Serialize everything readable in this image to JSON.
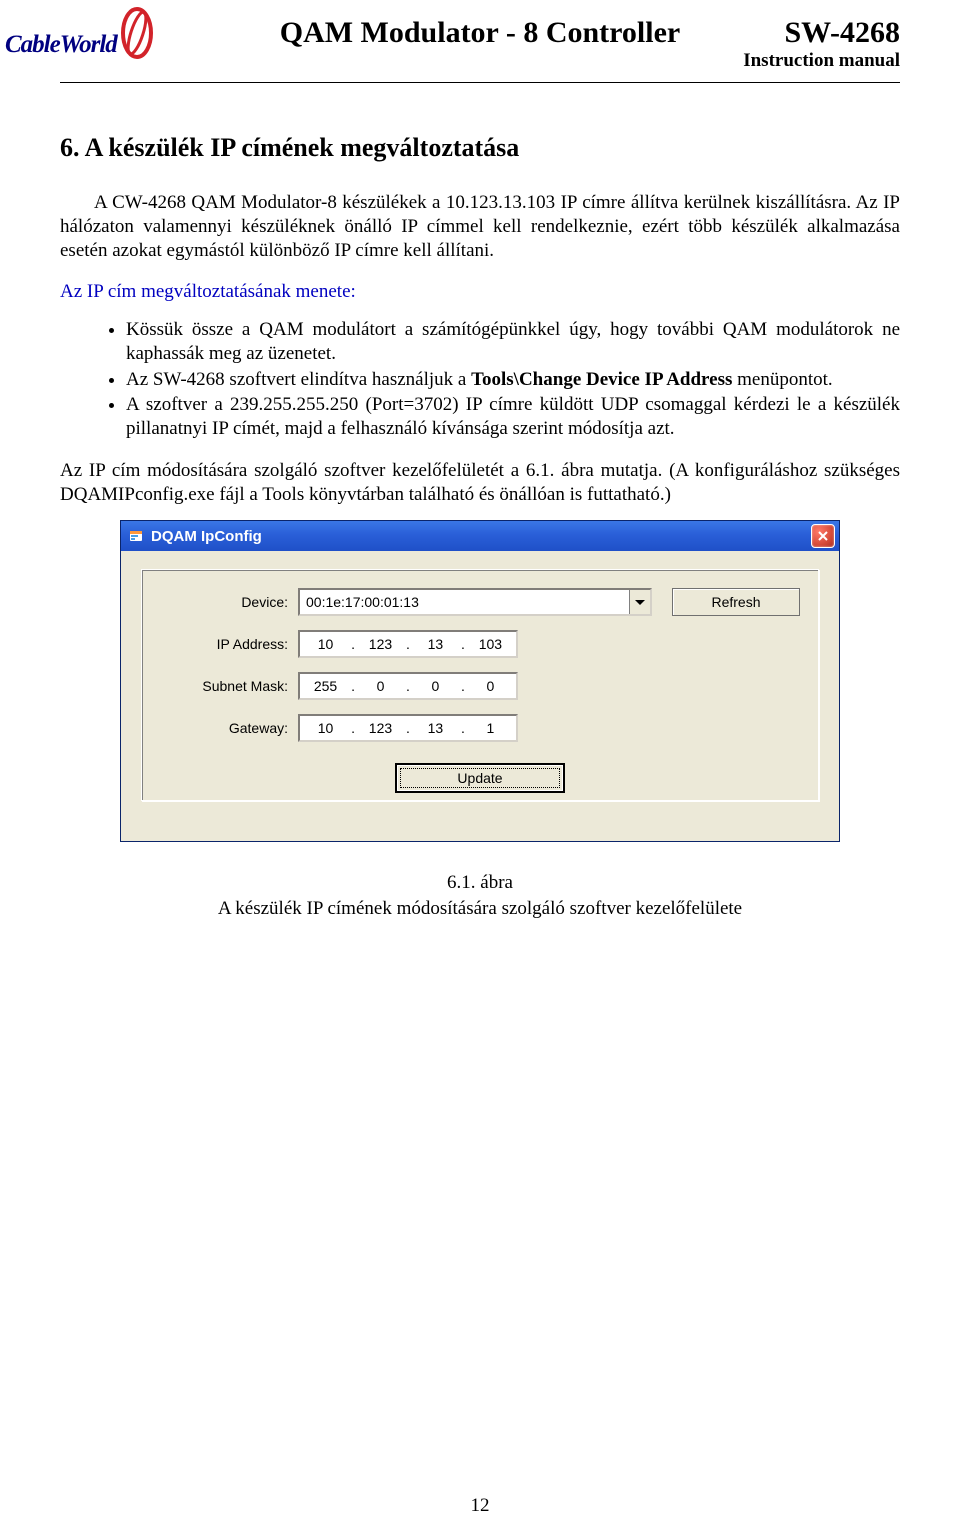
{
  "header": {
    "logo_text": "CableWorld",
    "title": "QAM Modulator - 8  Controller",
    "sw": "SW-4268",
    "subtitle": "Instruction manual"
  },
  "section": {
    "number_title": "6.   A készülék IP címének megváltoztatása"
  },
  "para1": "A CW-4268 QAM Modulator-8 készülékek a 10.123.13.103 IP címre állítva kerülnek kiszállításra. Az IP hálózaton valamennyi készüléknek önálló IP címmel kell rendelkeznie, ezért több készülék alkalmazása esetén azokat egymástól különböző IP címre kell állítani.",
  "para2_blue": "Az IP cím megváltoztatásának menete:",
  "bullets": {
    "b1": "Kössük össze a QAM modulátort a számítógépünkkel úgy, hogy további QAM modulátorok ne kaphassák meg az üzenetet.",
    "b2_pre": "Az SW-4268 szoftvert elindítva használjuk a ",
    "b2_bold": "Tools\\Change Device IP Address",
    "b2_post": " menüpontot.",
    "b3": "A szoftver a 239.255.255.250 (Port=3702) IP címre küldött UDP csomaggal kérdezi le a készülék pillanatnyi IP címét, majd a felhasználó kívánsága szerint módosítja azt."
  },
  "para3": "Az IP cím módosítására szolgáló szoftver kezelőfelületét a 6.1. ábra mutatja. (A konfiguráláshoz szükséges DQAMIPconfig.exe fájl a Tools könyvtárban található és önállóan is futtatható.)",
  "dialog": {
    "title": "DQAM IpConfig",
    "labels": {
      "device": "Device:",
      "ip": "IP Address:",
      "subnet": "Subnet Mask:",
      "gateway": "Gateway:"
    },
    "values": {
      "device_mac": "00:1e:17:00:01:13",
      "ip": [
        "10",
        "123",
        "13",
        "103"
      ],
      "subnet": [
        "255",
        "0",
        "0",
        "0"
      ],
      "gateway": [
        "10",
        "123",
        "13",
        "1"
      ]
    },
    "buttons": {
      "refresh": "Refresh",
      "update": "Update"
    }
  },
  "caption": {
    "line1": "6.1. ábra",
    "line2": "A készülék IP címének módosítására szolgáló szoftver kezelőfelülete"
  },
  "page_number": "12"
}
